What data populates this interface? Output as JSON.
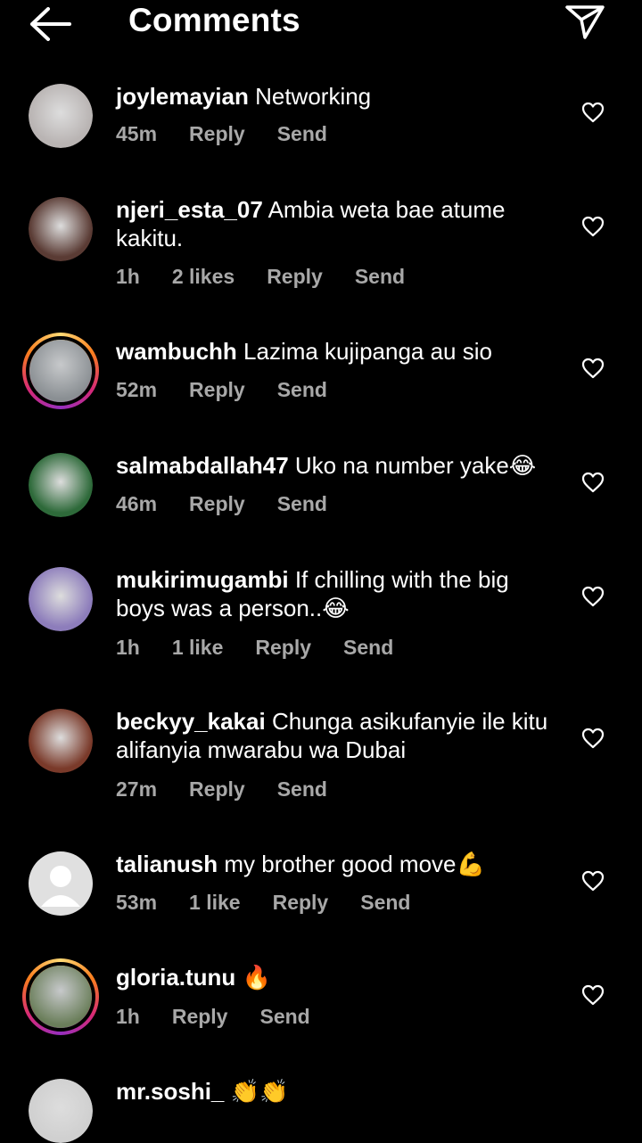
{
  "header": {
    "title": "Comments",
    "back_icon": "arrow-left-icon",
    "send_icon": "paper-plane-icon"
  },
  "comments": [
    {
      "user": "joylemayian",
      "text": "Networking",
      "time": "45m",
      "likes": "",
      "reply": "Reply",
      "send": "Send",
      "ring": false
    },
    {
      "user": "njeri_esta_07",
      "text": "Ambia weta bae atume kakitu.",
      "time": "1h",
      "likes": "2 likes",
      "reply": "Reply",
      "send": "Send",
      "ring": false
    },
    {
      "user": "wambuchh",
      "text": "Lazima kujipanga au sio",
      "time": "52m",
      "likes": "",
      "reply": "Reply",
      "send": "Send",
      "ring": true
    },
    {
      "user": "salmabdallah47",
      "text": "Uko na number yake😂",
      "time": "46m",
      "likes": "",
      "reply": "Reply",
      "send": "Send",
      "ring": false
    },
    {
      "user": "mukirimugambi",
      "text": "If chilling with the big boys was a person..😂",
      "time": "1h",
      "likes": "1 like",
      "reply": "Reply",
      "send": "Send",
      "ring": false
    },
    {
      "user": "beckyy_kakai",
      "text": "Chunga asikufanyie ile kitu alifanyia mwarabu wa Dubai",
      "time": "27m",
      "likes": "",
      "reply": "Reply",
      "send": "Send",
      "ring": false
    },
    {
      "user": "talianush",
      "text": "my brother good move💪",
      "time": "53m",
      "likes": "1 like",
      "reply": "Reply",
      "send": "Send",
      "ring": false
    },
    {
      "user": "gloria.tunu",
      "text": "🔥",
      "time": "1h",
      "likes": "",
      "reply": "Reply",
      "send": "Send",
      "ring": true
    },
    {
      "user": "mr.soshi_",
      "text": "👏👏",
      "time": "",
      "likes": "",
      "reply": "",
      "send": "",
      "ring": false
    }
  ],
  "colors": {
    "background": "#000000",
    "text": "#ffffff",
    "meta": "#a8a8a8"
  }
}
